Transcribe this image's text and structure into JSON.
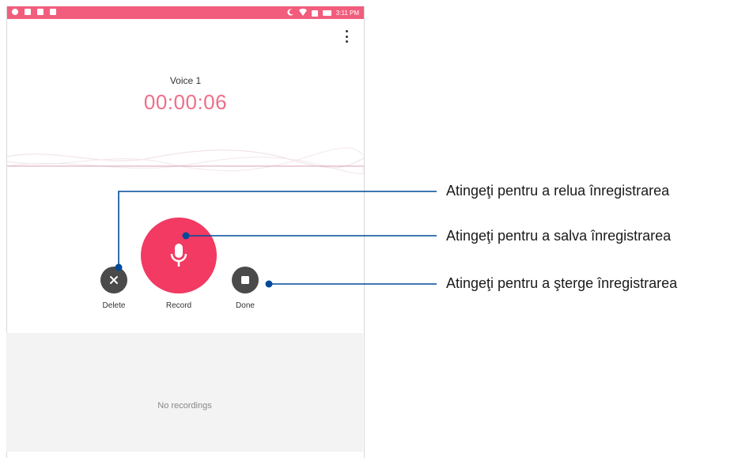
{
  "status_bar": {
    "time": "3:11 PM",
    "color": "#f25d7d",
    "left_icons": [
      "mic-status-icon",
      "message-icon",
      "usb-icon",
      "sd-card-icon"
    ],
    "right_icons": [
      "moon-icon",
      "wifi-icon",
      "battery-saver-icon",
      "battery-icon"
    ]
  },
  "toolbar": {
    "menu_icon": "more-vert-icon"
  },
  "recording": {
    "name": "Voice 1",
    "timer": "00:00:06",
    "timer_color": "#ef6e89"
  },
  "controls": {
    "delete_label": "Delete",
    "record_label": "Record",
    "done_label": "Done",
    "record_color": "#f23a62",
    "secondary_color": "#4a4a4a"
  },
  "recordings_list": {
    "empty_text": "No recordings"
  },
  "callouts": {
    "delete": "Atingeţi pentru a relua înregistrarea",
    "record": "Atingeţi pentru a salva înregistrarea",
    "done": "Atingeţi pentru a şterge înregistrarea",
    "line_color": "#004a99"
  }
}
